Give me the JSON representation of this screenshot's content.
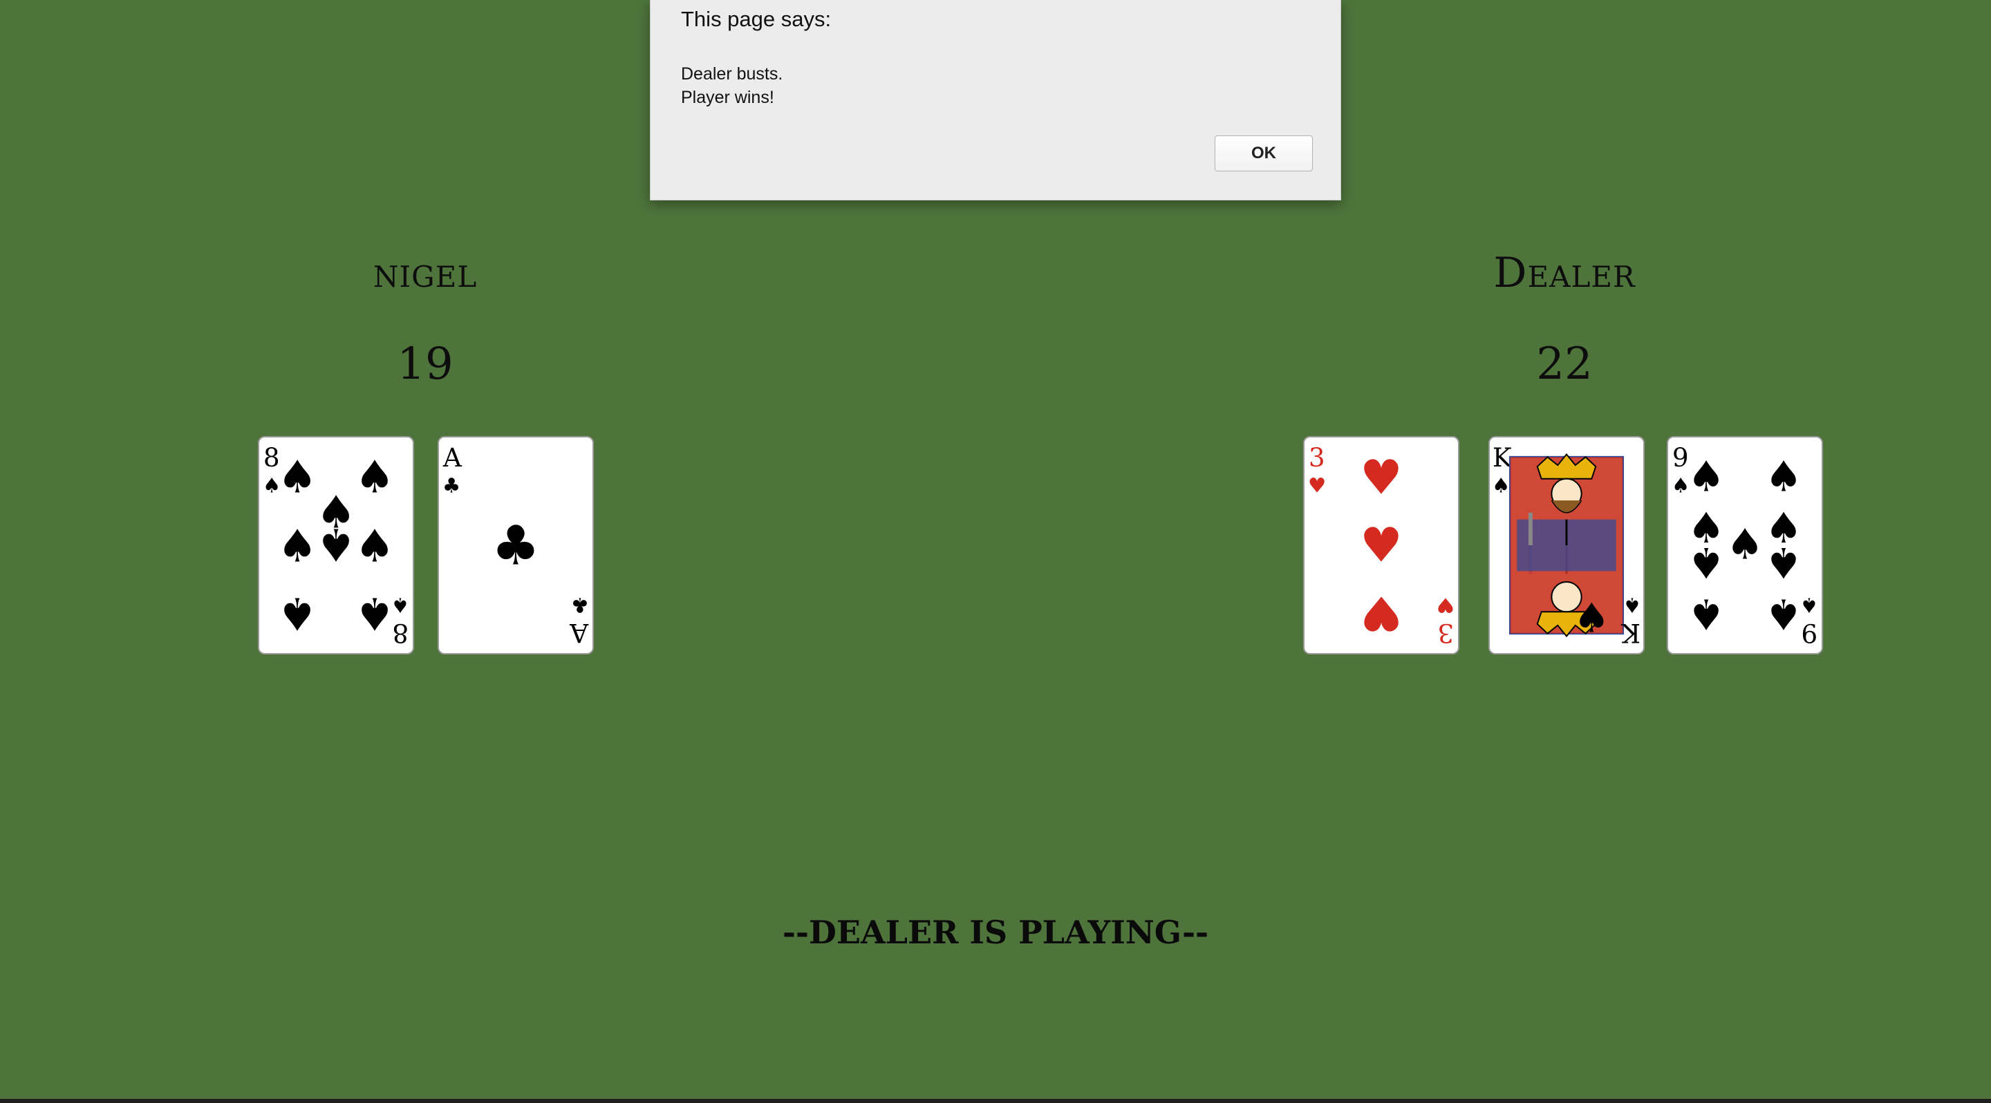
{
  "alert": {
    "title": "This page says:",
    "message": "Dealer busts.\nPlayer wins!",
    "ok_label": "OK"
  },
  "players": [
    {
      "name": "nigel",
      "score": "19",
      "cards": [
        {
          "rank": "8",
          "suit": "spades"
        },
        {
          "rank": "A",
          "suit": "clubs"
        }
      ]
    },
    {
      "name": "Dealer",
      "score": "22",
      "cards": [
        {
          "rank": "3",
          "suit": "hearts"
        },
        {
          "rank": "K",
          "suit": "spades"
        },
        {
          "rank": "9",
          "suit": "spades"
        }
      ]
    }
  ],
  "status": "--DEALER IS PLAYING--",
  "colors": {
    "table": "#4e743b",
    "red_suit": "#d42a20",
    "black_suit": "#000000"
  }
}
